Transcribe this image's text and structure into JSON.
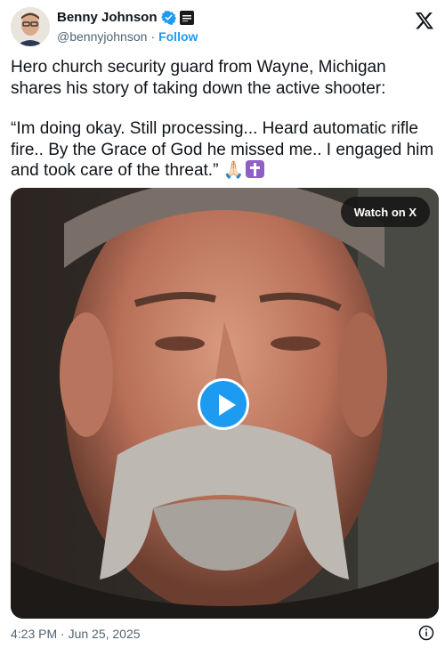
{
  "author": {
    "name": "Benny Johnson",
    "handle": "@bennyjohnson",
    "separator": "·",
    "follow_label": "Follow"
  },
  "icons": {
    "verified": "verified-badge-icon",
    "affiliate": "affiliate-badge-icon",
    "platform": "x-logo-icon",
    "info": "info-icon",
    "play": "play-icon"
  },
  "tweet": {
    "paragraph1": "Hero church security guard from Wayne, Michigan shares his story of taking down the active shooter:",
    "paragraph2": "“Im doing okay. Still processing... Heard automatic rifle fire.. By the Grace of God he missed me.. I engaged him and took care of the threat.”",
    "emoji_pray": "🙏🏻"
  },
  "media": {
    "watch_label": "Watch on X"
  },
  "footer": {
    "timestamp": "4:23 PM · Jun 25, 2025"
  },
  "colors": {
    "accent": "#1d9bf0",
    "text": "#0f1419",
    "secondary": "#536471"
  }
}
